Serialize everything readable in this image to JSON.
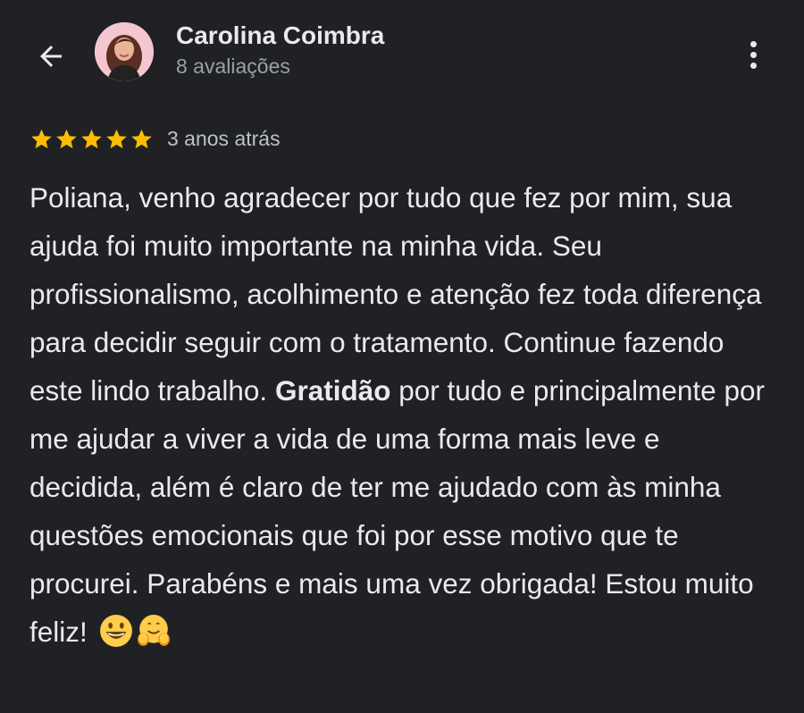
{
  "header": {
    "back_icon": "arrow-left-icon",
    "author_name": "Carolina Coimbra",
    "author_reviews": "8 avaliações",
    "more_icon": "more-vertical-icon"
  },
  "review": {
    "rating": 5,
    "rating_max": 5,
    "time": "3 anos atrás",
    "text_part1": "Poliana, venho agradecer por tudo que fez por mim, sua ajuda foi muito importante na minha vida. Seu profissionalismo, acolhimento e atenção fez toda diferença para decidir seguir com o tratamento. Continue fazendo este lindo trabalho.",
    "text_bold": "Gratidão",
    "text_part2": " por tudo e principalmente por me ajudar a viver a vida de uma forma mais leve e decidida, além é claro de ter me ajudado com às minha questões emocionais que foi por esse motivo que te procurei. Parabéns e mais uma vez obrigada! Estou muito feliz! ",
    "emojis": [
      "grinning-face-emoji",
      "hugging-face-emoji"
    ]
  },
  "colors": {
    "background": "#202124",
    "text_primary": "#e8eaed",
    "text_secondary": "#9aa0a6",
    "star": "#fbbc04",
    "avatar_bg": "#f4c6cf"
  }
}
